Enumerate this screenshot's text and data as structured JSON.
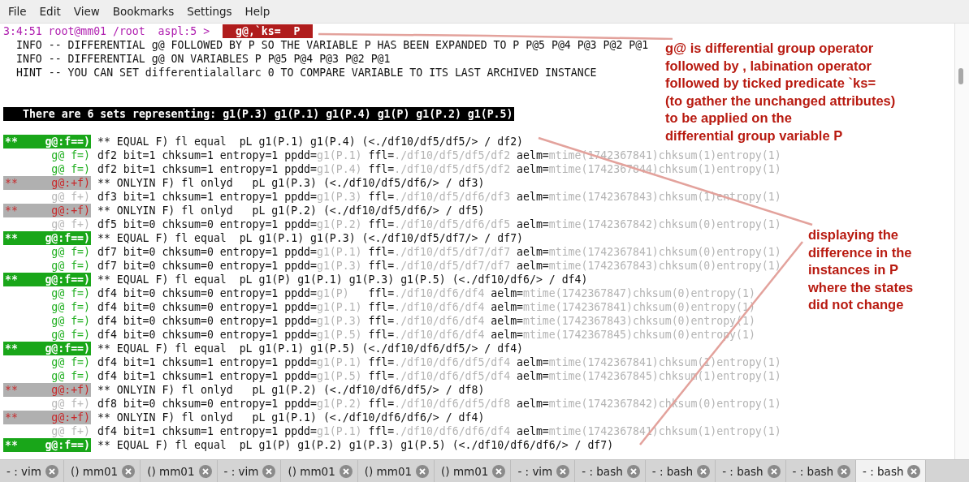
{
  "menu": [
    "File",
    "Edit",
    "View",
    "Bookmarks",
    "Settings",
    "Help"
  ],
  "terminal": {
    "prompt": "3:4:51 root@mm01 /root  aspl:5 >",
    "command": "g@,`ks=  P",
    "lines": [
      {
        "kind": "text",
        "text": "INFO -- DIFFERENTIAL g@ FOLLOWED BY P SO THE VARIABLE P HAS BEEN EXPANDED TO P P@5 P@4 P@3 P@2 P@1"
      },
      {
        "kind": "text",
        "text": "INFO -- DIFFERENTIAL g@ ON VARIABLES P P@5 P@4 P@3 P@2 P@1"
      },
      {
        "kind": "text",
        "text": "HINT -- YOU CAN SET differentialallarc 0 TO COMPARE VARIABLE TO ITS LAST ARCHIVED INSTANCE"
      },
      {
        "kind": "blank"
      },
      {
        "kind": "blank"
      },
      {
        "kind": "banner",
        "text": "There are 6 sets representing: g1(P.3) g1(P.1) g1(P.4) g1(P) g1(P.2) g1(P.5)"
      },
      {
        "kind": "blank"
      },
      {
        "kind": "group",
        "matched": true,
        "stars": "**",
        "tag": "g@:f==)",
        "text": "** EQUAL F) fl equal  pL g1(P.1) g1(P.4) (<./df10/df5/df5/> / df2)"
      },
      {
        "kind": "detail",
        "matched": true,
        "tag": "g@ f=)",
        "parts": [
          "df2 bit=1 chksum=1 entropy=1 ppdd=",
          "g1(P.1)",
          " ffl=",
          "./df10/df5/df5/df2",
          " aelm=",
          "mtime(1742367841)chksum(1)entropy(1)"
        ]
      },
      {
        "kind": "detail",
        "matched": true,
        "tag": "g@ f=)",
        "parts": [
          "df2 bit=1 chksum=1 entropy=1 ppdd=",
          "g1(P.4)",
          " ffl=",
          "./df10/df5/df5/df2",
          " aelm=",
          "mtime(1742367844)chksum(1)entropy(1)"
        ]
      },
      {
        "kind": "group",
        "matched": false,
        "stars": "**",
        "tag": "g@:+f)",
        "text": "** ONLYIN F) fl onlyd   pL g1(P.3) (<./df10/df5/df6/> / df3)"
      },
      {
        "kind": "detail",
        "matched": false,
        "tag": "g@ f+)",
        "parts": [
          "df3 bit=1 chksum=1 entropy=1 ppdd=",
          "g1(P.3)",
          " ffl=",
          "./df10/df5/df6/df3",
          " aelm=",
          "mtime(1742367843)chksum(1)entropy(1)"
        ]
      },
      {
        "kind": "group",
        "matched": false,
        "stars": "**",
        "tag": "g@:+f)",
        "text": "** ONLYIN F) fl onlyd   pL g1(P.2) (<./df10/df5/df6/> / df5)"
      },
      {
        "kind": "detail",
        "matched": false,
        "tag": "g@ f+)",
        "parts": [
          "df5 bit=0 chksum=0 entropy=1 ppdd=",
          "g1(P.2)",
          " ffl=",
          "./df10/df5/df6/df5",
          " aelm=",
          "mtime(1742367842)chksum(0)entropy(1)"
        ]
      },
      {
        "kind": "group",
        "matched": true,
        "stars": "**",
        "tag": "g@:f==)",
        "text": "** EQUAL F) fl equal  pL g1(P.1) g1(P.3) (<./df10/df5/df7/> / df7)"
      },
      {
        "kind": "detail",
        "matched": true,
        "tag": "g@ f=)",
        "parts": [
          "df7 bit=0 chksum=0 entropy=1 ppdd=",
          "g1(P.1)",
          " ffl=",
          "./df10/df5/df7/df7",
          " aelm=",
          "mtime(1742367841)chksum(0)entropy(1)"
        ]
      },
      {
        "kind": "detail",
        "matched": true,
        "tag": "g@ f=)",
        "parts": [
          "df7 bit=0 chksum=0 entropy=1 ppdd=",
          "g1(P.3)",
          " ffl=",
          "./df10/df5/df7/df7",
          " aelm=",
          "mtime(1742367843)chksum(0)entropy(1)"
        ]
      },
      {
        "kind": "group",
        "matched": true,
        "stars": "**",
        "tag": "g@:f==)",
        "text": "** EQUAL F) fl equal  pL g1(P) g1(P.1) g1(P.3) g1(P.5) (<./df10/df6/> / df4)"
      },
      {
        "kind": "detail",
        "matched": true,
        "tag": "g@ f=)",
        "parts": [
          "df4 bit=0 chksum=0 entropy=1 ppdd=",
          "g1(P)",
          "   ffl=",
          "./df10/df6/df4",
          " aelm=",
          "mtime(1742367847)chksum(0)entropy(1)"
        ]
      },
      {
        "kind": "detail",
        "matched": true,
        "tag": "g@ f=)",
        "parts": [
          "df4 bit=0 chksum=0 entropy=1 ppdd=",
          "g1(P.1)",
          " ffl=",
          "./df10/df6/df4",
          " aelm=",
          "mtime(1742367841)chksum(0)entropy(1)"
        ]
      },
      {
        "kind": "detail",
        "matched": true,
        "tag": "g@ f=)",
        "parts": [
          "df4 bit=0 chksum=0 entropy=1 ppdd=",
          "g1(P.3)",
          " ffl=",
          "./df10/df6/df4",
          " aelm=",
          "mtime(1742367843)chksum(0)entropy(1)"
        ]
      },
      {
        "kind": "detail",
        "matched": true,
        "tag": "g@ f=)",
        "parts": [
          "df4 bit=0 chksum=0 entropy=1 ppdd=",
          "g1(P.5)",
          " ffl=",
          "./df10/df6/df4",
          " aelm=",
          "mtime(1742367845)chksum(0)entropy(1)"
        ]
      },
      {
        "kind": "group",
        "matched": true,
        "stars": "**",
        "tag": "g@:f==)",
        "text": "** EQUAL F) fl equal  pL g1(P.1) g1(P.5) (<./df10/df6/df5/> / df4)"
      },
      {
        "kind": "detail",
        "matched": true,
        "tag": "g@ f=)",
        "parts": [
          "df4 bit=1 chksum=1 entropy=1 ppdd=",
          "g1(P.1)",
          " ffl=",
          "./df10/df6/df5/df4",
          " aelm=",
          "mtime(1742367841)chksum(1)entropy(1)"
        ]
      },
      {
        "kind": "detail",
        "matched": true,
        "tag": "g@ f=)",
        "parts": [
          "df4 bit=1 chksum=1 entropy=1 ppdd=",
          "g1(P.5)",
          " ffl=",
          "./df10/df6/df5/df4",
          " aelm=",
          "mtime(1742367845)chksum(1)entropy(1)"
        ]
      },
      {
        "kind": "group",
        "matched": false,
        "stars": "**",
        "tag": "g@:+f)",
        "text": "** ONLYIN F) fl onlyd   pL g1(P.2) (<./df10/df6/df5/> / df8)"
      },
      {
        "kind": "detail",
        "matched": false,
        "tag": "g@ f+)",
        "parts": [
          "df8 bit=0 chksum=0 entropy=1 ppdd=",
          "g1(P.2)",
          " ffl=",
          "./df10/df6/df5/df8",
          " aelm=",
          "mtime(1742367842)chksum(0)entropy(1)"
        ]
      },
      {
        "kind": "group",
        "matched": false,
        "stars": "**",
        "tag": "g@:+f)",
        "text": "** ONLYIN F) fl onlyd   pL g1(P.1) (<./df10/df6/df6/> / df4)"
      },
      {
        "kind": "detail",
        "matched": false,
        "tag": "g@ f+)",
        "parts": [
          "df4 bit=1 chksum=1 entropy=1 ppdd=",
          "g1(P.1)",
          " ffl=",
          "./df10/df6/df6/df4",
          " aelm=",
          "mtime(1742367841)chksum(1)entropy(1)"
        ]
      },
      {
        "kind": "group",
        "matched": true,
        "stars": "**",
        "tag": "g@:f==)",
        "text": "** EQUAL F) fl equal  pL g1(P) g1(P.2) g1(P.3) g1(P.5) (<./df10/df6/df6/> / df7)"
      }
    ]
  },
  "annotations": [
    {
      "lines": [
        "g@ is differential group operator",
        "followed by , labination operator",
        "followed by ticked predicate `ks=",
        "(to gather the unchanged attributes)",
        "to be applied on the",
        "differential group variable P"
      ]
    },
    {
      "lines": [
        "displaying the",
        "difference in the",
        "instances in P",
        "where the states",
        "did not change"
      ]
    }
  ],
  "tabs": [
    {
      "label": "- : vim",
      "selected": false
    },
    {
      "label": "() mm01",
      "selected": false
    },
    {
      "label": "() mm01",
      "selected": false
    },
    {
      "label": "- : vim",
      "selected": false
    },
    {
      "label": "() mm01",
      "selected": false
    },
    {
      "label": "() mm01",
      "selected": false
    },
    {
      "label": "() mm01",
      "selected": false
    },
    {
      "label": "- : vim",
      "selected": false
    },
    {
      "label": "- : bash",
      "selected": false
    },
    {
      "label": "- : bash",
      "selected": false
    },
    {
      "label": "- : bash",
      "selected": false
    },
    {
      "label": "- : bash",
      "selected": false
    },
    {
      "label": "- : bash",
      "selected": true
    }
  ]
}
